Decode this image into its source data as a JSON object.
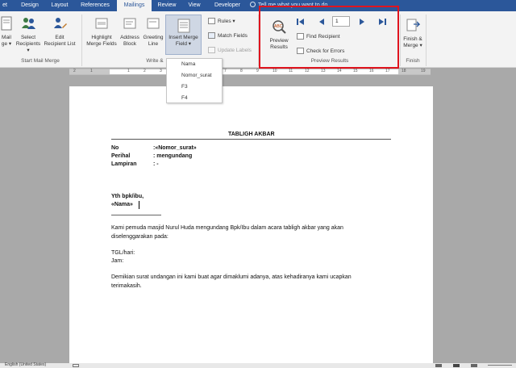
{
  "tabs": [
    {
      "label": "et",
      "active": false
    },
    {
      "label": "Design",
      "active": false
    },
    {
      "label": "Layout",
      "active": false
    },
    {
      "label": "References",
      "active": false
    },
    {
      "label": "Mailings",
      "active": true
    },
    {
      "label": "Review",
      "active": false
    },
    {
      "label": "View",
      "active": false
    },
    {
      "label": "Developer",
      "active": false
    }
  ],
  "tell_me": "Tell me what you want to do...",
  "ribbon": {
    "start": {
      "mail_line1": "Mail",
      "mail_line2": "ge ▾",
      "select_line1": "Select",
      "select_line2": "Recipients ▾",
      "edit_line1": "Edit",
      "edit_line2": "Recipient List",
      "group_label": "Start Mail Merge"
    },
    "write": {
      "highlight_line1": "Highlight",
      "highlight_line2": "Merge Fields",
      "address_line1": "Address",
      "address_line2": "Block",
      "greeting_line1": "Greeting",
      "greeting_line2": "Line",
      "insert_line1": "Insert Merge",
      "insert_line2": "Field ▾",
      "rules": "Rules ▾",
      "match_fields": "Match Fields",
      "update_labels": "Update Labels",
      "group_label": "Write &"
    },
    "preview": {
      "preview_line1": "Preview",
      "preview_line2": "Results",
      "record_number": "1",
      "find_recipient": "Find Recipient",
      "check_errors": "Check for Errors",
      "group_label": "Preview Results"
    },
    "finish": {
      "finish_line1": "Finish &",
      "finish_line2": "Merge ▾",
      "group_label": "Finish"
    }
  },
  "dropdown_fields": [
    "Nama",
    "Nomor_surat",
    "F3",
    "F4"
  ],
  "ruler_numbers": [
    "2",
    "1",
    "1",
    "2",
    "3",
    "4",
    "5",
    "6",
    "7",
    "8",
    "9",
    "10",
    "11",
    "12",
    "13",
    "14",
    "15",
    "16",
    "17",
    "18",
    "19"
  ],
  "document": {
    "title": "TABLIGH AKBAR",
    "no_label": "No",
    "no_value": ":«Nomor_surat»",
    "perihal_label": "Perihal",
    "perihal_value": ": mengundang",
    "lampiran_label": "Lampiran",
    "lampiran_value": ": -",
    "to_line": "Yth bpk/ibu,",
    "name_field": "«Nama»",
    "para1_line1": "Kami pemuda masjid Nurul Huda mengundang Bpk/Ibu dalam acara tabligh akbar yang akan",
    "para1_line2": "diselenggarakan pada:",
    "tgl": "TGL/hari:",
    "jam": "Jam:",
    "para2_line1": "Demikian surat undangan ini kami buat agar dimaklumi adanya, atas kehadiranya kami ucapkan",
    "para2_line2": "terimakasih."
  },
  "status": {
    "language": "English (United States)"
  }
}
